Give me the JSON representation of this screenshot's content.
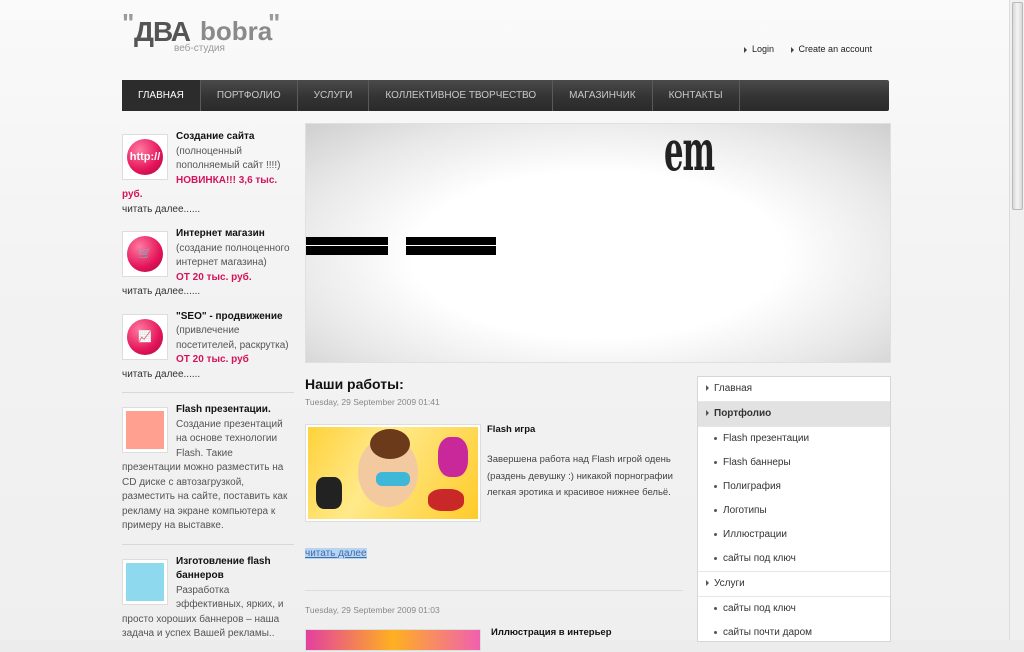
{
  "logo": {
    "dva": "ДВА",
    "bobra": "bobra",
    "quote_open": "\"",
    "quote_close": "\"",
    "subtitle": "веб-студия"
  },
  "toplinks": {
    "login": "Login",
    "create": "Create an account"
  },
  "nav": [
    {
      "label": "ГЛАВНАЯ"
    },
    {
      "label": "ПОРТФОЛИО"
    },
    {
      "label": "УСЛУГИ"
    },
    {
      "label": "КОЛЛЕКТИВНОЕ ТВОРЧЕСТВО"
    },
    {
      "label": "МАГАЗИНЧИК"
    },
    {
      "label": "КОНТАКТЫ"
    }
  ],
  "services": [
    {
      "icon_text": "http://",
      "title": "Создание сайта",
      "desc": "(полноценный пополняемый сайт !!!!)",
      "price": "НОВИНКА!!!   3,6 тыс. руб.",
      "more": "читать далее......"
    },
    {
      "icon_text": "🛒",
      "title": "Интернет магазин",
      "desc": "(создание полноценного интернет магазина)",
      "price": "ОТ 20 тыс. руб.",
      "more": "читать далее......"
    },
    {
      "icon_text": "📈",
      "title": "\"SEO\" - продвижение",
      "desc": "(привлечение посетителей, раскрутка)",
      "price": "ОТ 20 тыс. руб",
      "more": "читать далее......"
    }
  ],
  "flash": [
    {
      "title": "Flash презентации.",
      "text": "Создание презентаций на основе технологии Flash. Такие презентации можно разместить на CD диске с автозагрузкой, разместить на сайте, поставить как рекламу на экране компьютера к примеру на выставке.",
      "color": "#ffa090"
    },
    {
      "title": "Изготовление flash баннеров",
      "text": "Разработка эффективных, ярких, и просто хороших баннеров – наша задача и успех Вашей рекламы..",
      "color": "#8fd9ef"
    }
  ],
  "banner": {
    "text": "em"
  },
  "content": {
    "heading": "Наши работы:",
    "date1": "Tuesday, 29 September 2009 01:41",
    "work1_title": "Flash игра",
    "work1_text": "Завершена работа над Flash игрой одень (раздень девушку :) никакой порнографии легкая эротика и красивое нижнее бельё.",
    "readmore": "читать далее",
    "date2": "Tuesday, 29 September 2009 01:03",
    "work2_title": "Иллюстрация в интерьер"
  },
  "rmenu": {
    "home": "Главная",
    "portfolio": "Портфолио",
    "portfolio_items": [
      "Flash презентации",
      "Flash баннеры",
      "Полиграфия",
      "Логотипы",
      "Иллюстрации",
      "сайты под ключ"
    ],
    "services": "Услуги",
    "service_items": [
      "сайты под ключ",
      "сайты почти даром"
    ]
  }
}
